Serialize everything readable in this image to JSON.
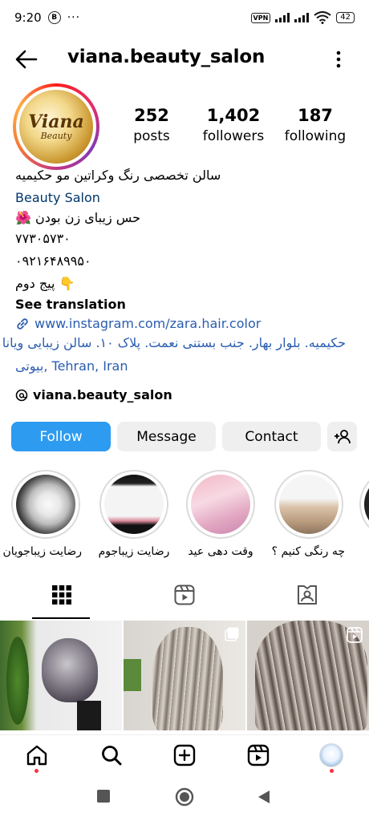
{
  "status_bar": {
    "time": "9:20",
    "b_icon": "B",
    "dots": "···",
    "vpn": "VPN",
    "wifi_sub": "6",
    "battery": "42"
  },
  "header": {
    "username": "viana.beauty_salon"
  },
  "profile": {
    "avatar_logo": "Viana",
    "avatar_sub": "Beauty",
    "stats": [
      {
        "value": "252",
        "label": "posts"
      },
      {
        "value": "1,402",
        "label": "followers"
      },
      {
        "value": "187",
        "label": "following"
      }
    ]
  },
  "bio": {
    "line1": "سالن تخصصی رنگ وکراتین مو حکیمیه",
    "category": "Beauty Salon",
    "line3": "حس زیبای زن بودن",
    "line3_emoji": "🌺",
    "phone1": "۷۷۳۰۵۷۳۰",
    "phone2": "۰۹۲۱۶۴۸۹۹۵۰",
    "line6": "پیج دوم",
    "line6_emoji": "👇",
    "see_translation": "See translation",
    "website": "www.instagram.com/zara.hair.color",
    "address_line1": "حکیمیه. بلوار بهار. جنب بستنی نعمت. پلاک ۱۰. سالن زیبایی ویانا",
    "address_line2_fa": "بیوتی",
    "address_line2_en": ", Tehran, Iran",
    "threads_handle": "viana.beauty_salon"
  },
  "buttons": {
    "follow": "Follow",
    "message": "Message",
    "contact": "Contact"
  },
  "highlights": [
    {
      "label": "رضایت زیباجویان"
    },
    {
      "label": "رضایت زیباجوم"
    },
    {
      "label": "وقت دهی عید"
    },
    {
      "label": "چه رنگی کنیم ؟"
    }
  ],
  "tabs": [
    "grid-icon",
    "reels-icon",
    "tagged-icon"
  ],
  "colors": {
    "follow_blue": "#2d9bf0",
    "link": "#00376b",
    "button_gray": "#efefef",
    "notification_red": "#ff3040"
  }
}
